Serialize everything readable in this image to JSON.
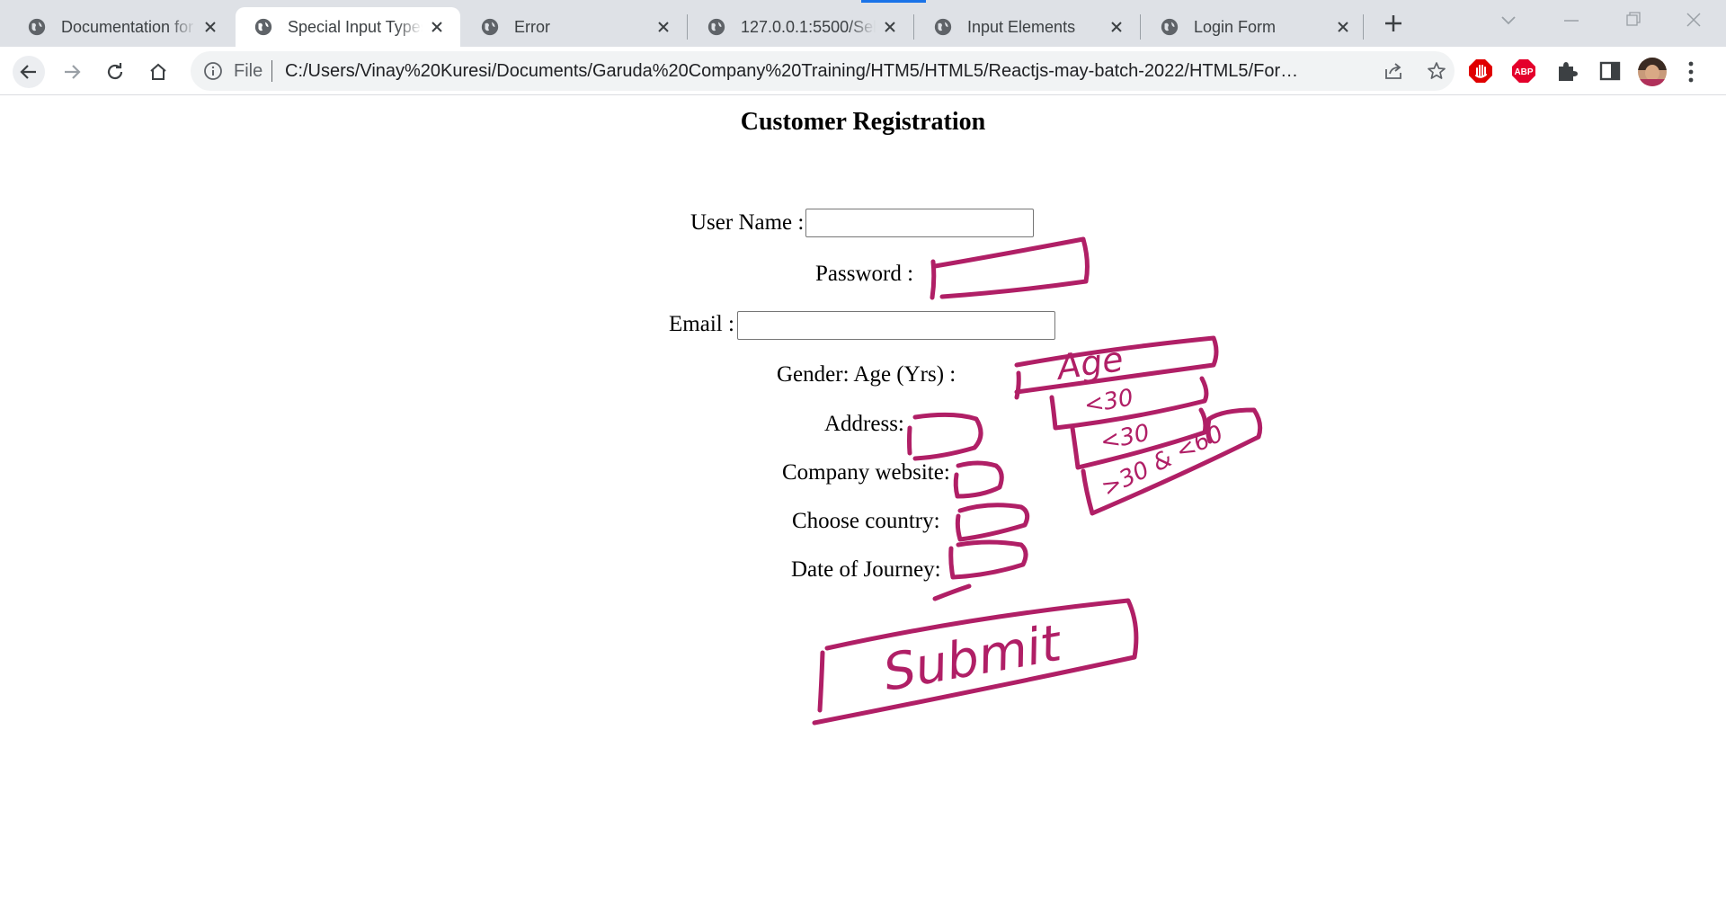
{
  "browser": {
    "tabs": [
      {
        "title": "Documentation for",
        "active": false
      },
      {
        "title": "Special Input Types",
        "active": true
      },
      {
        "title": "Error",
        "active": false
      },
      {
        "title": "127.0.0.1:5500/Sele",
        "active": false
      },
      {
        "title": "Input Elements",
        "active": false
      },
      {
        "title": "Login Form",
        "active": false
      }
    ],
    "address": {
      "scheme": "File",
      "url": "C:/Users/Vinay%20Kuresi/Documents/Garuda%20Company%20Training/HTM5/HTML5/Reactjs-may-batch-2022/HTML5/Forms..."
    },
    "extensions": {
      "abp_label": "ABP"
    }
  },
  "form": {
    "heading": "Customer Registration",
    "username_label": "User Name :",
    "username_value": "",
    "password_label": "Password :",
    "email_label": "Email :",
    "email_value": "",
    "gender_age_label": "Gender: Age (Yrs) :",
    "address_label": "Address:",
    "website_label": "Company website:",
    "country_label": "Choose country:",
    "journey_label": "Date of Journey:"
  },
  "annotations": {
    "age_select": "Age",
    "age_option_1": "<30",
    "age_option_2": "<30",
    "age_option_3": ">30 & <60",
    "submit": "Submit"
  },
  "colors": {
    "ink": "#b01f66",
    "tab_indicator": "#1a73e8",
    "tabstrip": "#dee1e6"
  }
}
